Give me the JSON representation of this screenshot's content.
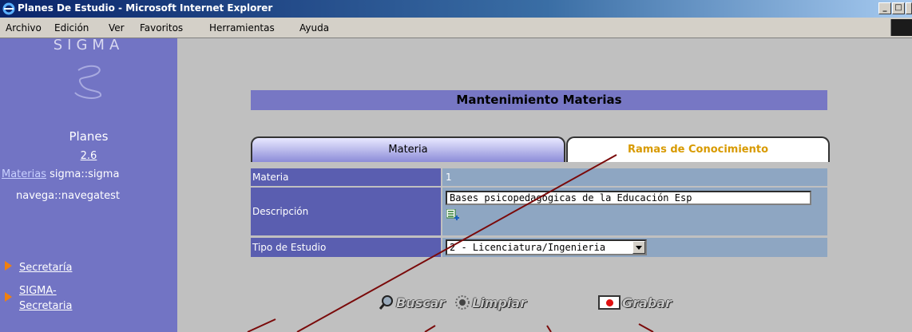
{
  "window": {
    "title": "Planes De Estudio - Microsoft Internet Explorer",
    "buttons": [
      "_",
      "□",
      "×"
    ]
  },
  "menu": [
    "Archivo",
    "Edición",
    "Ver",
    "Favoritos",
    "Herramientas",
    "Ayuda"
  ],
  "sidebar": {
    "logo_text": "SIGMA",
    "app_name": "Planes",
    "version": "2.6",
    "materias_link": "Materias",
    "user": "sigma::sigma",
    "navega": "navega::navegatest",
    "links": [
      "Secretaría",
      "SIGMA-",
      "Secretaria"
    ]
  },
  "main": {
    "title": "Mantenimiento Materias",
    "tabs": [
      "Materia",
      "Ramas de Conocimiento"
    ],
    "fields": {
      "materia_label": "Materia",
      "materia_value": "1",
      "descripcion_label": "Descripción",
      "descripcion_value": "Bases psicopedagógicas de la Educación Esp",
      "tipo_label": "Tipo de Estudio",
      "tipo_value": "2 - Licenciatura/Ingenieria"
    },
    "actions": {
      "buscar": "Buscar",
      "limpiar": "Limpiar",
      "grabar": "Grabar"
    }
  },
  "colors": {
    "sidebar": "#7274c4",
    "header": "#7777c4",
    "label_cell": "#5a5eb0",
    "value_cell": "#8ea6c2",
    "tab_active_text": "#d89a00",
    "annotation_line": "#7a0a0a"
  }
}
